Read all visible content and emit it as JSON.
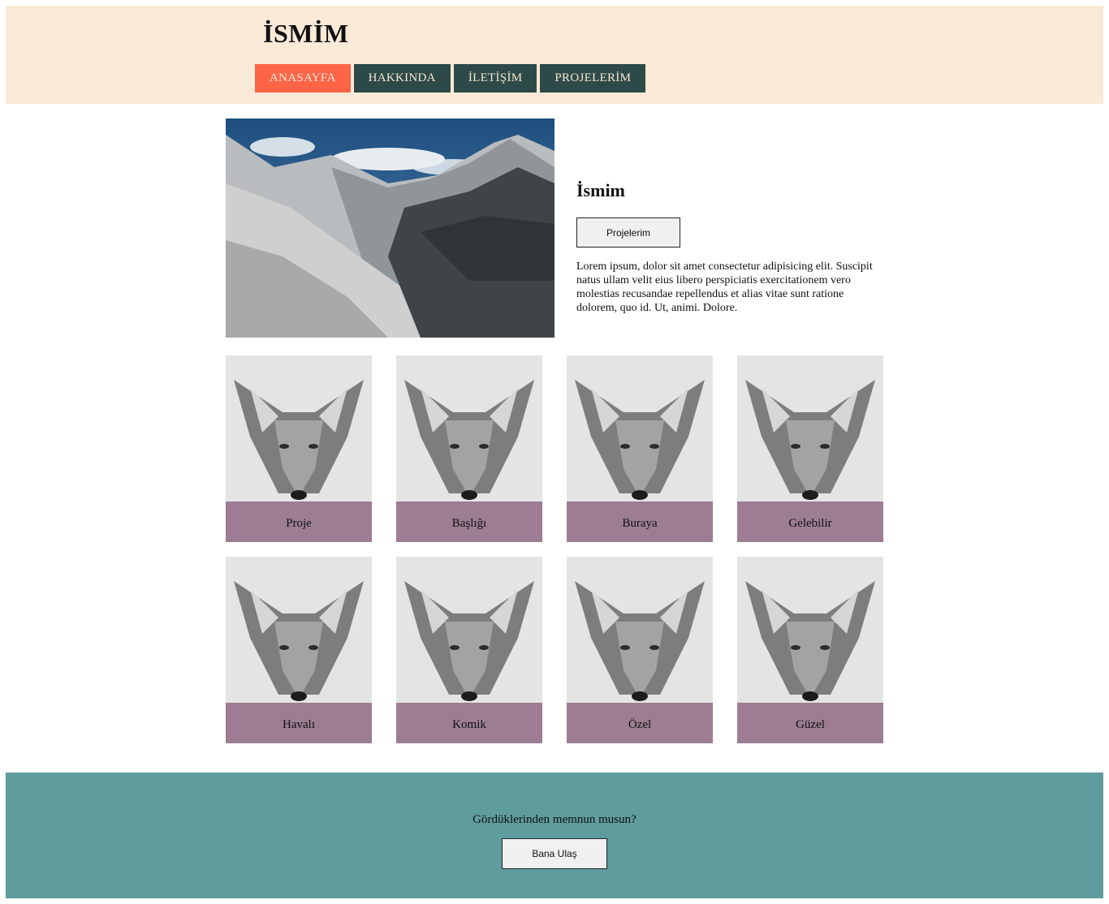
{
  "header": {
    "title": "İSMİM",
    "nav": [
      {
        "label": "ANASAYFA",
        "active": true
      },
      {
        "label": "HAKKINDA",
        "active": false
      },
      {
        "label": "İLETİŞİM",
        "active": false
      },
      {
        "label": "PROJELERİM",
        "active": false
      }
    ]
  },
  "hero": {
    "name": "İsmim",
    "projects_button": "Projelerim",
    "text": "Lorem ipsum, dolor sit amet consectetur adipisicing elit. Suscipit natus ullam velit eius libero perspiciatis exercitationem vero molestias recusandae repellendus et alias vitae sunt ratione dolorem, quo id. Ut, animi. Dolore."
  },
  "projects": [
    {
      "label": "Proje"
    },
    {
      "label": "Başlığı"
    },
    {
      "label": "Buraya"
    },
    {
      "label": "Gelebilir"
    },
    {
      "label": "Havalı"
    },
    {
      "label": "Komik"
    },
    {
      "label": "Özel"
    },
    {
      "label": "Güzel"
    }
  ],
  "footer": {
    "question": "Gördüklerinden memnun musun?",
    "contact_button": "Bana Ulaş"
  },
  "colors": {
    "header_bg": "#f9ead7",
    "nav_bg": "#2d4a49",
    "nav_active_bg": "#fd6546",
    "card_label_bg": "#9c7d93",
    "footer_bg": "#5f9c9d"
  }
}
